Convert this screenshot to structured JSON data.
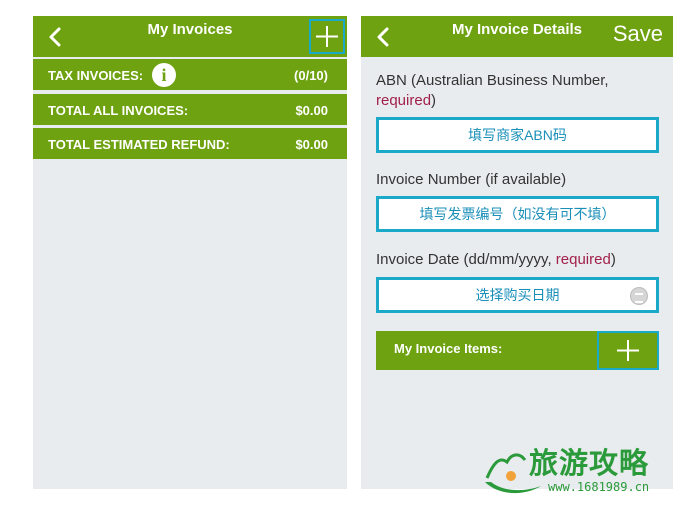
{
  "left_screen": {
    "title": "My Invoices",
    "rows": [
      {
        "label": "TAX INVOICES:",
        "value": "(0/10)"
      },
      {
        "label": "TOTAL ALL INVOICES:",
        "value": "$0.00"
      },
      {
        "label": "TOTAL ESTIMATED REFUND:",
        "value": "$0.00"
      }
    ]
  },
  "right_screen": {
    "title": "My Invoice Details",
    "save_label": "Save",
    "abn": {
      "label": "ABN (Australian Business Number,",
      "required": "required",
      "suffix": ")",
      "placeholder": "填写商家ABN码"
    },
    "invoice_number": {
      "label": "Invoice Number (if available)",
      "placeholder": "填写发票编号（如没有可不填）"
    },
    "invoice_date": {
      "label": "Invoice Date (dd/mm/yyyy, ",
      "required": "required",
      "suffix": ")",
      "placeholder": "选择购买日期"
    },
    "items_label": "My Invoice Items:"
  },
  "watermark": {
    "title": "旅游攻略",
    "url": "www.1681989.cn"
  },
  "colors": {
    "brand_green": "#6ea210",
    "accent_cyan": "#1aa9c9",
    "required_red": "#a2214a",
    "panel_bg": "#e8ecee"
  },
  "icons": [
    "back-icon",
    "plus-icon",
    "info-icon",
    "calendar-icon"
  ]
}
